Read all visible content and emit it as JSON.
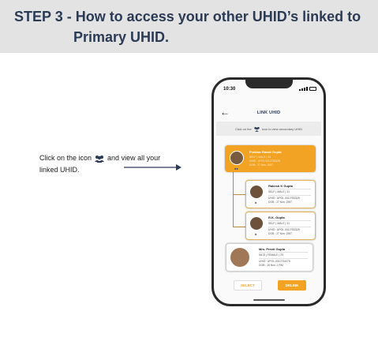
{
  "banner": {
    "line1": "STEP 3 - How to access your other UHID’s linked to",
    "line2": "Primary UHID."
  },
  "instruction": {
    "part1": "Click on the icon",
    "part2": "and view all your",
    "line2": "linked UHID.",
    "icon": "users-group-icon"
  },
  "phone": {
    "time": "10:30",
    "title": "LINK UHID",
    "hint_part1": "Click on the",
    "hint_part2": "icon to view secondary UHID",
    "primary": {
      "name": "Prakhar Rawat Gupta",
      "line1": "SELF  |  MALE  |  31",
      "line2": "UHID : AP01.0012783329",
      "line3": "DOB : 27 Nov. 1987"
    },
    "secondary": [
      {
        "name": "Rakesh K Gupta",
        "line1": "SELF  |  MALE  |  31",
        "line2": "UHID : APOL.0012783329",
        "line3": "DOB : 27 Nov. 1987"
      },
      {
        "name": "R.K. Gupta",
        "line1": "SELF  |  MALE  |  31",
        "line2": "UHID : APOL.0012783329",
        "line3": "DOB : 27 Nov. 1987"
      }
    ],
    "other": {
      "name": "Mrs. Preeti Gupta",
      "line1": "NICE  |  FEMALE  |  29",
      "line2": "UHID : APOL.0012734475",
      "line3": "DOB : 18 Nov. 1 RM"
    },
    "select_label": "SELECT",
    "delink_label": "DELINK"
  },
  "colors": {
    "accent": "#f3a323",
    "navy": "#2b3a55",
    "banner_bg": "#e3e3e3"
  }
}
